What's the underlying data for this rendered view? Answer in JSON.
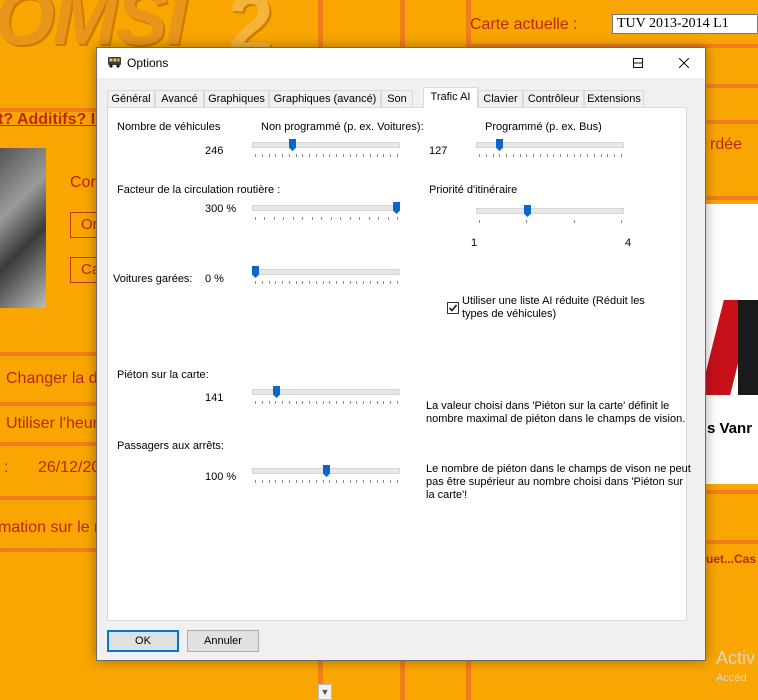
{
  "background": {
    "logo_text": "OMSI",
    "logo_number": "2",
    "map_label": "Carte actuelle :",
    "map_value": "TUV 2013-2014 L1",
    "question_text": "t? Additifs? Ir",
    "con_text": "Cor",
    "btn1_label": "Or",
    "btn2_label": "Ca",
    "change_text": "Changer la d",
    "use_time_text": "Utiliser l'heur",
    "date_colon": ":",
    "date_text": "26/12/20",
    "info_text": "mation sur le m",
    "rdee_text": "rdée",
    "uet_text": "uet...Cas",
    "banner_text": "s Vanr",
    "activate_text": "Activ",
    "activate_sub": "Accéd"
  },
  "dialog": {
    "title": "Options",
    "tabs": [
      "Général",
      "Avancé",
      "Graphiques",
      "Graphiques (avancé)",
      "Son",
      "Trafic AI",
      "Clavier",
      "Contrôleur",
      "Extensions"
    ],
    "active_tab": "Trafic AI",
    "labels": {
      "vehicles": "Nombre de véhicules",
      "non_scheduled": "Non programmé (p. ex. Voitures):",
      "scheduled": "Programmé (p. ex. Bus)",
      "road_factor": "Facteur de la circulation routière :",
      "route_priority": "Priorité d'itinéraire",
      "parked_cars": "Voitures garées:",
      "pedestrians_map": "Piéton sur la carte:",
      "passengers_stops": "Passagers aux arrêts:"
    },
    "values": {
      "non_scheduled": "246",
      "scheduled": "127",
      "road_factor": "300 %",
      "route_min": "1",
      "route_max": "4",
      "parked_cars": "0 %",
      "pedestrians": "141",
      "passengers": "100 %"
    },
    "slider_positions": {
      "non_scheduled": 0.26,
      "scheduled": 0.14,
      "road_factor": 1.0,
      "route_priority": 0.34,
      "parked_cars": 0.0,
      "pedestrians": 0.15,
      "passengers": 0.5
    },
    "checkbox_label_line1": "Utiliser une liste AI réduite (Réduit les",
    "checkbox_label_line2": "types de véhicules)",
    "checkbox_checked": true,
    "info1_line1": "La valeur choisi dans 'Piéton sur la carte' définit le",
    "info1_line2": "nombre maximal de piéton dans le champs de vision.",
    "info2_line1": "Le nombre de piéton dans le champs de vison ne peut",
    "info2_line2": "pas être supérieur au nombre choisi dans 'Piéton sur",
    "info2_line3": "la carte'!",
    "ok_label": "OK",
    "cancel_label": "Annuler"
  },
  "colors": {
    "background": "#f9a602",
    "accent_red": "#b82a0a",
    "slider_thumb": "#0a66c8",
    "default_button_border": "#0078d7"
  }
}
